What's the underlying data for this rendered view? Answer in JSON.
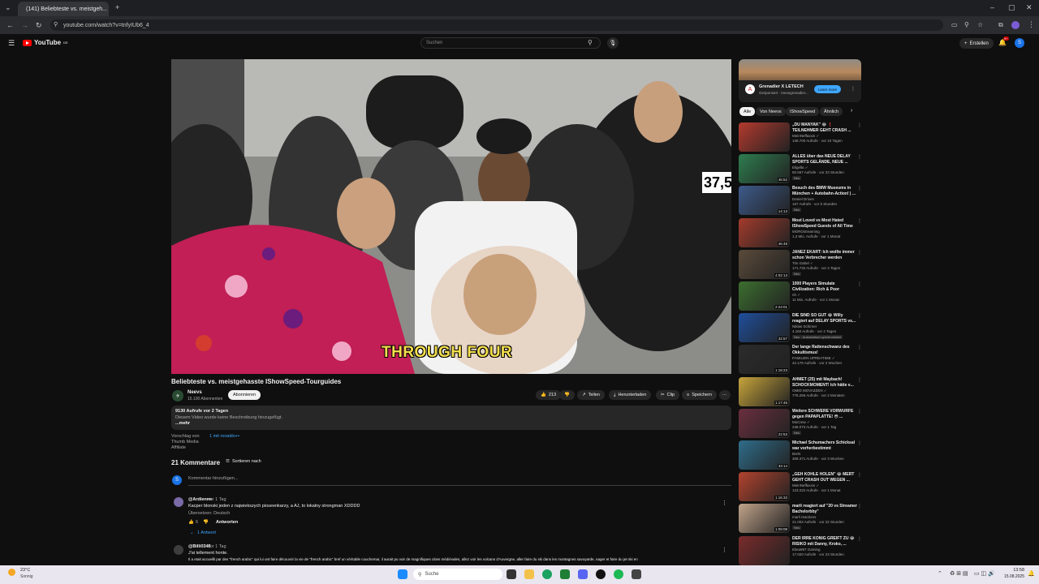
{
  "browser": {
    "tab_title": "(141) Beliebteste vs. meistgeh...",
    "url": "youtube.com/watch?v=tnfyIUb6_4"
  },
  "header": {
    "logo": "YouTube",
    "logo_country": "DE",
    "search_placeholder": "Suchen",
    "create_label": "Erstellen",
    "notif_count": "9+",
    "avatar_letter": "S"
  },
  "video": {
    "caption": "THROUGH FOUR",
    "counter": "37,5",
    "title": "Beliebteste vs. meistgehasste IShowSpeed-Tourguides"
  },
  "channel": {
    "name": "Neevs",
    "subscribers": "15.100 Abonnenten",
    "subscribe_label": "Abonnieren"
  },
  "actions": {
    "likes": "213",
    "share": "Teilen",
    "download": "Herunterladen",
    "clip": "Clip",
    "save": "Speichern"
  },
  "description": {
    "meta": "9130 Aufrufe  vor 2 Tagen",
    "text": "Diesem Video wurde keine Beschreibung hinzugefügt.",
    "more": "...mehr"
  },
  "suggestion": {
    "label": "Vorschlag von",
    "link": "1 mit ronaldo+•",
    "sub1": "Thumb Media",
    "sub2": "Affiliate"
  },
  "comments": {
    "count_label": "21 Kommentare",
    "sort_label": "Sortieren nach",
    "add_placeholder": "Kommentar hinzufügen...",
    "user_initial": "S",
    "items": [
      {
        "author": "@Ardienne",
        "time": "vor 1 Tag",
        "text": "Kacper blonski jeden z najwiekszych pioseenkarzy, a AJ, to lokalny strongman XDDDD",
        "translate": "Übersetzen: Deutsch",
        "likes": "6",
        "reply": "Antworten",
        "replies": "1 Antwort"
      },
      {
        "author": "@Billi0345",
        "time": "vor 1 Tag",
        "text": "J'ai tellement honte.",
        "text2": "Il a etait accueilli par des \"french arabic\" qui lui ont faire découvrir la vie de \"french arabic\" bref un véritable couchemar, il aurait pu voir de magnifiques cities médiévales, allez voir les volcans d'Auvergne, aller faire du ski dans les montagnes savoyarde, nager et faire du jet ski en"
      }
    ]
  },
  "sidebar": {
    "ad": {
      "name": "Grenadier X LETECH",
      "sponsored": "Gesponsert · Ineosgrenadier...",
      "cta": "Learn more"
    },
    "chips": [
      "Alle",
      "Von Neevs",
      "IShowSpeed",
      "Ähnlich"
    ],
    "videos": [
      {
        "title": "„DU MANYAK\" 😂 ❗ TEILNEHMER GEHT CRASH ...",
        "channel": "MeinNeffaxxis ✓",
        "meta": "136.700 Aufrufe · vor 10 Tagen",
        "duration": "",
        "badge": ""
      },
      {
        "title": "ALLES über das NEUE DELAY SPORTS GELÄNDE, NEUE ...",
        "channel": "Eligella ✓",
        "meta": "50.567 Aufrufe · vor 23 Stunden",
        "duration": "45:52",
        "badge": "Neu"
      },
      {
        "title": "Besuch des BMW Museums in München + Autobahn-Action! | ...",
        "channel": "Daniel Drives",
        "meta": "167 Aufrufe · vor 5 Stunden",
        "duration": "14:13",
        "badge": "Neu"
      },
      {
        "title": "Most Loved vs Most Hated IShowSpeed Guests of All Time",
        "channel": "MOROstreaming",
        "meta": "1,3 Mio. Aufrufe · vor 1 Monat",
        "duration": "46:48",
        "badge": ""
      },
      {
        "title": "JANEZ EKART: Ich wollte immer schon Verbrecher werden",
        "channel": "Tim Gabel ✓",
        "meta": "171.732 Aufrufe · vor 4 Tagen",
        "duration": "4:02:13",
        "badge": "Neu"
      },
      {
        "title": "1000 Players Simulate Civilization: Rich & Poor",
        "channel": "nh ✓",
        "meta": "11 Mio. Aufrufe · vor 1 Monat",
        "duration": "2:24:01",
        "badge": ""
      },
      {
        "title": "DIE SIND SO GUT 😂 Willy reagiert auf DELAY SPORTS vs...",
        "channel": "Niklas Schirner",
        "meta": "4.160 Aufrufe · vor 4 Tagen",
        "duration": "32:57",
        "badge": "Neu · Automatisch synchronisiert"
      },
      {
        "title": "Der lange Rattenschwanz des Okkultismus!",
        "channel": "FAMILIEN UPREATIME ✓",
        "meta": "42.176 Aufrufe · vor 2 Wochen",
        "duration": "1:18:23",
        "badge": ""
      },
      {
        "title": "AHMET (25) mit Maybach! SCHOCKMOMENT! Ich hätte e...",
        "channel": "OMID MOVAZZEN ✓",
        "meta": "776.266 Aufrufe · vor 2 Monaten",
        "duration": "1:17:45",
        "badge": ""
      },
      {
        "title": "Weitere SCHWERE VORWÜRFE gegen PAPAPLATTE! 😳 ...",
        "channel": "MoCrew ✓",
        "meta": "238.073 Aufrufe · vor 1 Tag",
        "duration": "22:53",
        "badge": "Neu"
      },
      {
        "title": "Michael Schumachers Schicksal war vorherbestimmt",
        "channel": "BorN",
        "meta": "308.371 Aufrufe · vor 3 Wochen",
        "duration": "33:14",
        "badge": ""
      },
      {
        "title": "„GEH KOHLE HOLEN\" 😂 MERT GEHT CRASH OUT WEGEN ...",
        "channel": "MeinNeffaxxis ✓",
        "meta": "123.222 Aufrufe · vor 1 Monat",
        "duration": "1:16:33",
        "badge": ""
      },
      {
        "title": "marli reagiert auf \"20 vs Streamer Bachelorbby\"",
        "channel": "marli reactions",
        "meta": "21.002 Aufrufe · vor 22 Stunden",
        "duration": "1:09:08",
        "badge": "Neu"
      },
      {
        "title": "DER IRRE KÖNIG GREIFT ZU 😂 RISIKO mit Danny, Kroko, ...",
        "channel": "Eliea997 Gaming",
        "meta": "17.020 Aufrufe · vor 23 Stunden",
        "duration": "",
        "badge": ""
      }
    ]
  },
  "taskbar": {
    "weather_temp": "23°C",
    "weather_desc": "Sonnig",
    "search_label": "Suche",
    "time": "13:58",
    "date": "15.08.2025"
  }
}
